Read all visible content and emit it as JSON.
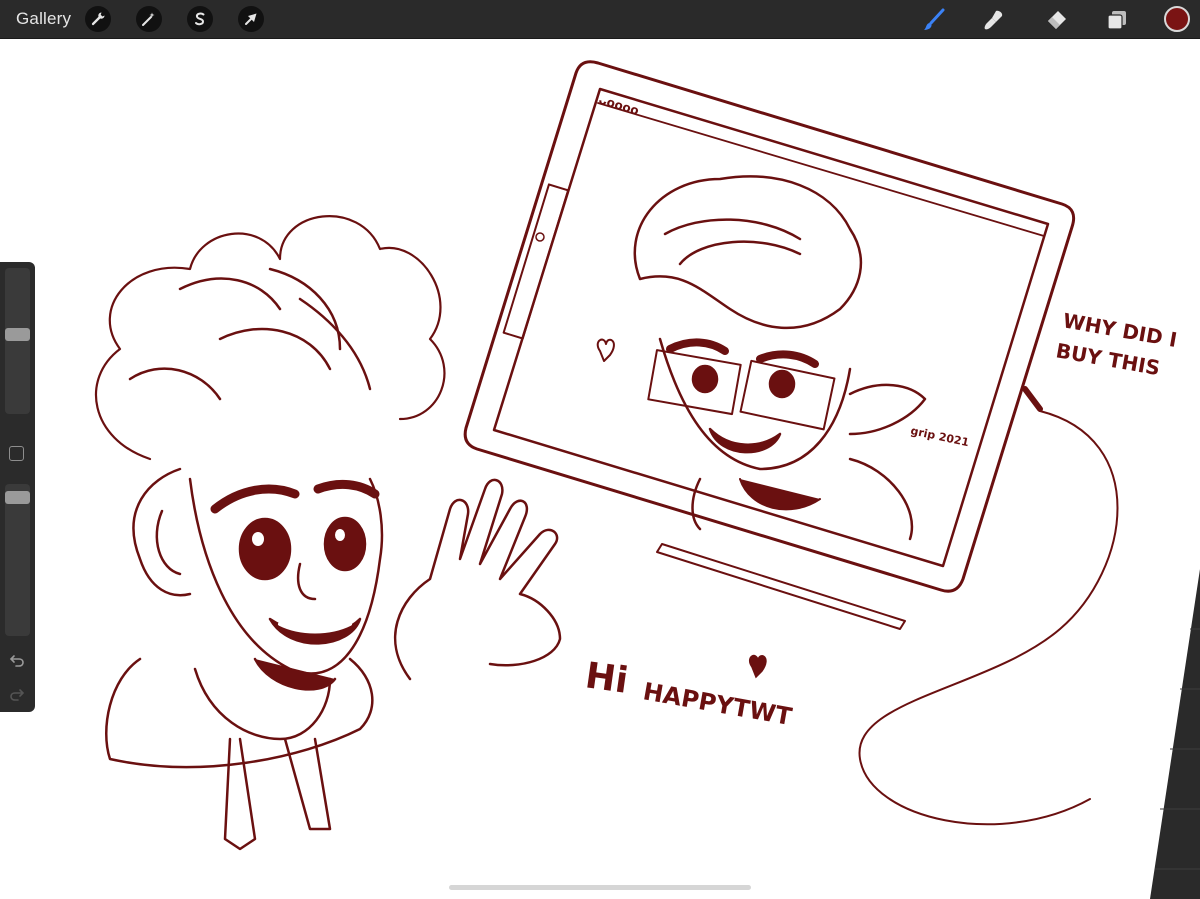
{
  "toolbar": {
    "gallery_label": "Gallery",
    "left_tools": [
      {
        "name": "actions",
        "icon": "wrench-icon"
      },
      {
        "name": "adjustments",
        "icon": "magic-wand-icon"
      },
      {
        "name": "selection",
        "icon": "selection-s-icon"
      },
      {
        "name": "transform",
        "icon": "arrow-cursor-icon"
      }
    ],
    "right_tools": [
      {
        "name": "brush",
        "icon": "brush-icon",
        "active": true
      },
      {
        "name": "smudge",
        "icon": "smudge-icon"
      },
      {
        "name": "eraser",
        "icon": "eraser-icon"
      },
      {
        "name": "layers",
        "icon": "layers-icon"
      }
    ],
    "current_color": "#7a1414",
    "active_tool_color": "#3b82f6"
  },
  "sidebar": {
    "brush_size_level": 0.45,
    "opacity_level": 0.05,
    "modify_icon": "square-icon",
    "undo_icon": "undo-icon",
    "redo_icon": "redo-icon"
  },
  "canvas": {
    "ink_color": "#6a1010",
    "tablet_screen_stamp_letters": "ᴗᴏᴏᴏᴏ",
    "signature": "grip 2021",
    "annotations": {
      "tablet_caption_line1": "WHY DID I",
      "tablet_caption_line2": "BUY THIS",
      "greeting_hi": "Hi",
      "greeting_name": "HAPPYTWT"
    }
  }
}
